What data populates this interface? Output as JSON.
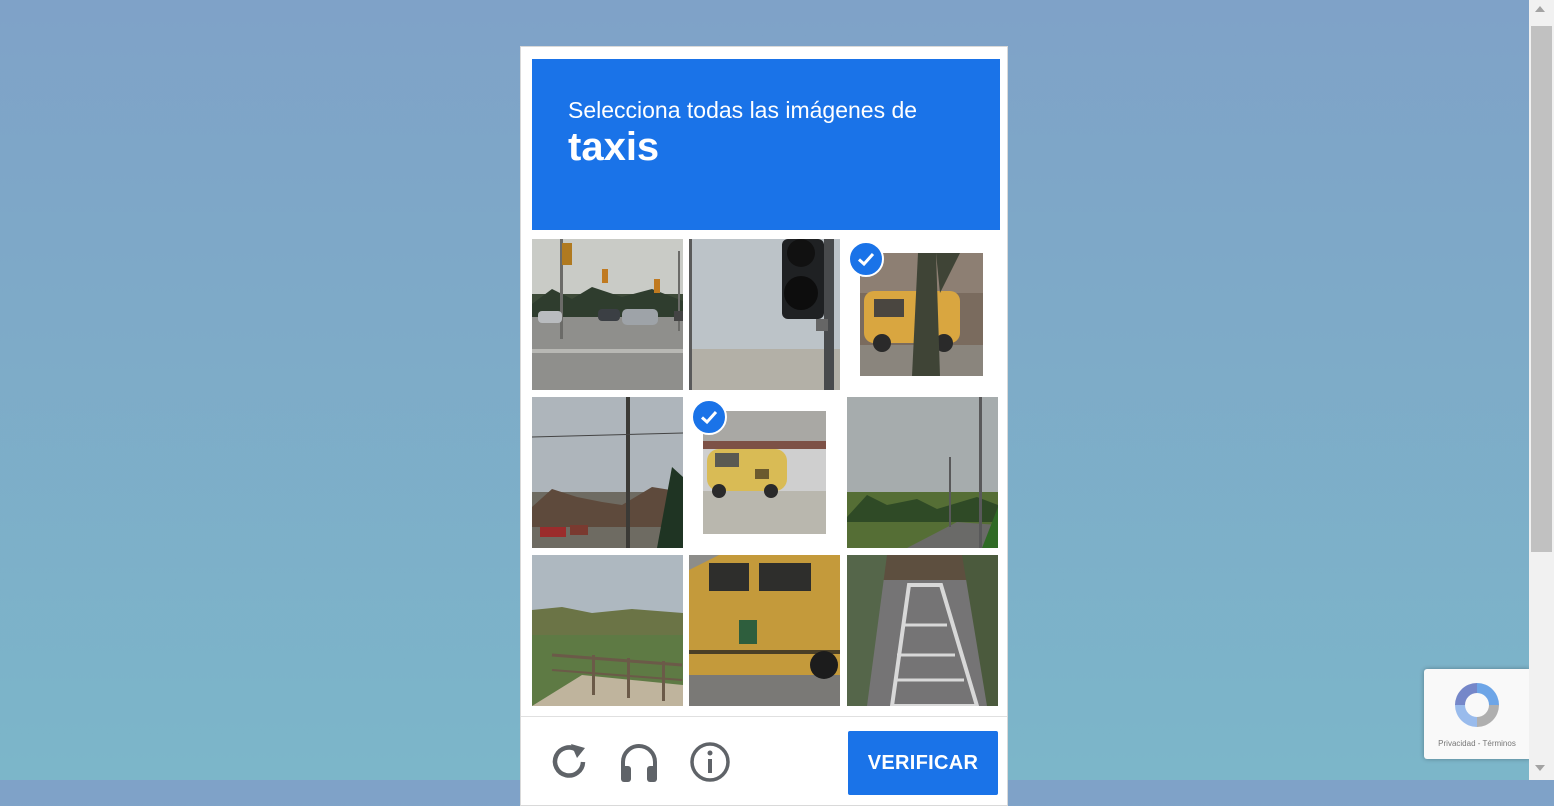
{
  "captcha": {
    "prompt": "Selecciona todas las imágenes de",
    "keyword": "taxis",
    "verify_label": "VERIFICAR",
    "tiles": [
      {
        "subject": "intersection with cars and traffic lights",
        "selected": false
      },
      {
        "subject": "traffic light pole against sky",
        "selected": false
      },
      {
        "subject": "yellow taxi behind a tree",
        "selected": true
      },
      {
        "subject": "utility pole near houses",
        "selected": false
      },
      {
        "subject": "yellow taxi van",
        "selected": true
      },
      {
        "subject": "road with trees and power lines",
        "selected": false
      },
      {
        "subject": "hillside with fence and vegetation",
        "selected": false
      },
      {
        "subject": "close-up of yellow taxi",
        "selected": false
      },
      {
        "subject": "road lane markings",
        "selected": false
      }
    ],
    "icons": [
      "reload-icon",
      "audio-icon",
      "info-icon"
    ]
  },
  "badge": {
    "legal_text": "Privacidad - Términos"
  },
  "colors": {
    "accent": "#1a73e8",
    "background_top": "#7fa2c8",
    "background_bottom": "#7cb6c9"
  }
}
